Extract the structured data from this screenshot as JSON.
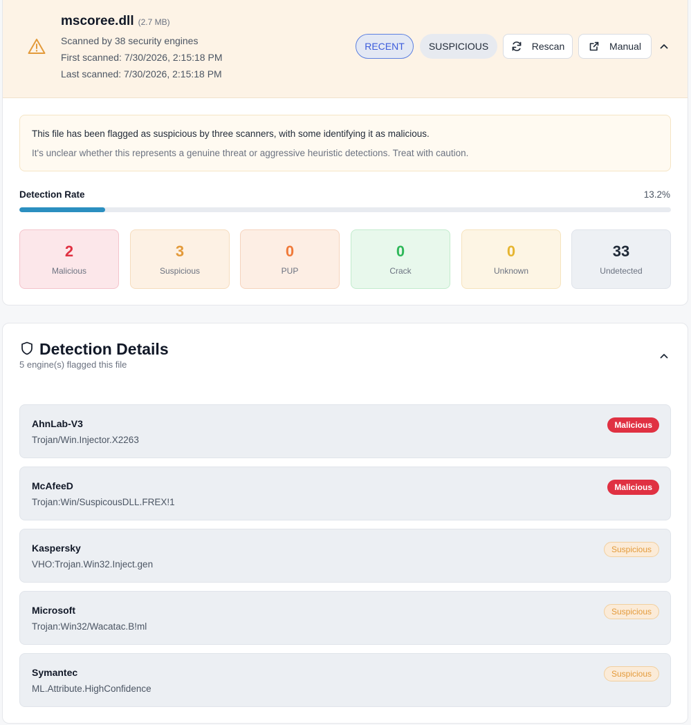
{
  "file": {
    "name": "mscoree.dll",
    "size": "(2.7 MB)",
    "scanned_by": "Scanned by 38 security engines",
    "first_scanned": "First scanned: 7/30/2026, 2:15:18 PM",
    "last_scanned": "Last scanned: 7/30/2026, 2:15:18 PM"
  },
  "actions": {
    "recent": "RECENT",
    "suspicious": "SUSPICIOUS",
    "rescan": "Rescan",
    "manual": "Manual"
  },
  "notice": {
    "line1": "This file has been flagged as suspicious by three scanners, with some identifying it as malicious.",
    "line2": "It's unclear whether this represents a genuine threat or aggressive heuristic detections. Treat with caution."
  },
  "detection_rate": {
    "label": "Detection Rate",
    "value_text": "13.2%",
    "fraction": 0.132
  },
  "stats": [
    {
      "count": "2",
      "label": "Malicious",
      "color": "#e03142",
      "bg": "#fce7ea",
      "border": "#f4c3cb"
    },
    {
      "count": "3",
      "label": "Suspicious",
      "color": "#e39a3a",
      "bg": "#fdf1e4",
      "border": "#f6dcbd"
    },
    {
      "count": "0",
      "label": "PUP",
      "color": "#f07a3a",
      "bg": "#fdeee4",
      "border": "#f6d3bd"
    },
    {
      "count": "0",
      "label": "Crack",
      "color": "#2fb85a",
      "bg": "#e8f8ec",
      "border": "#c2ebcd"
    },
    {
      "count": "0",
      "label": "Unknown",
      "color": "#e6b530",
      "bg": "#fdf5e4",
      "border": "#f6e3bd"
    },
    {
      "count": "33",
      "label": "Undetected",
      "color": "#1f2937",
      "bg": "#edf0f4",
      "border": "#dfe3ea"
    }
  ],
  "details": {
    "title": "Detection Details",
    "subtitle": "5 engine(s) flagged this file",
    "engines": [
      {
        "name": "AhnLab-V3",
        "signature": "Trojan/Win.Injector.X2263",
        "verdict": "Malicious"
      },
      {
        "name": "McAfeeD",
        "signature": "Trojan:Win/SuspicousDLL.FREX!1",
        "verdict": "Malicious"
      },
      {
        "name": "Kaspersky",
        "signature": "VHO:Trojan.Win32.Inject.gen",
        "verdict": "Suspicious"
      },
      {
        "name": "Microsoft",
        "signature": "Trojan:Win32/Wacatac.B!ml",
        "verdict": "Suspicious"
      },
      {
        "name": "Symantec",
        "signature": "ML.Attribute.HighConfidence",
        "verdict": "Suspicious"
      }
    ]
  }
}
